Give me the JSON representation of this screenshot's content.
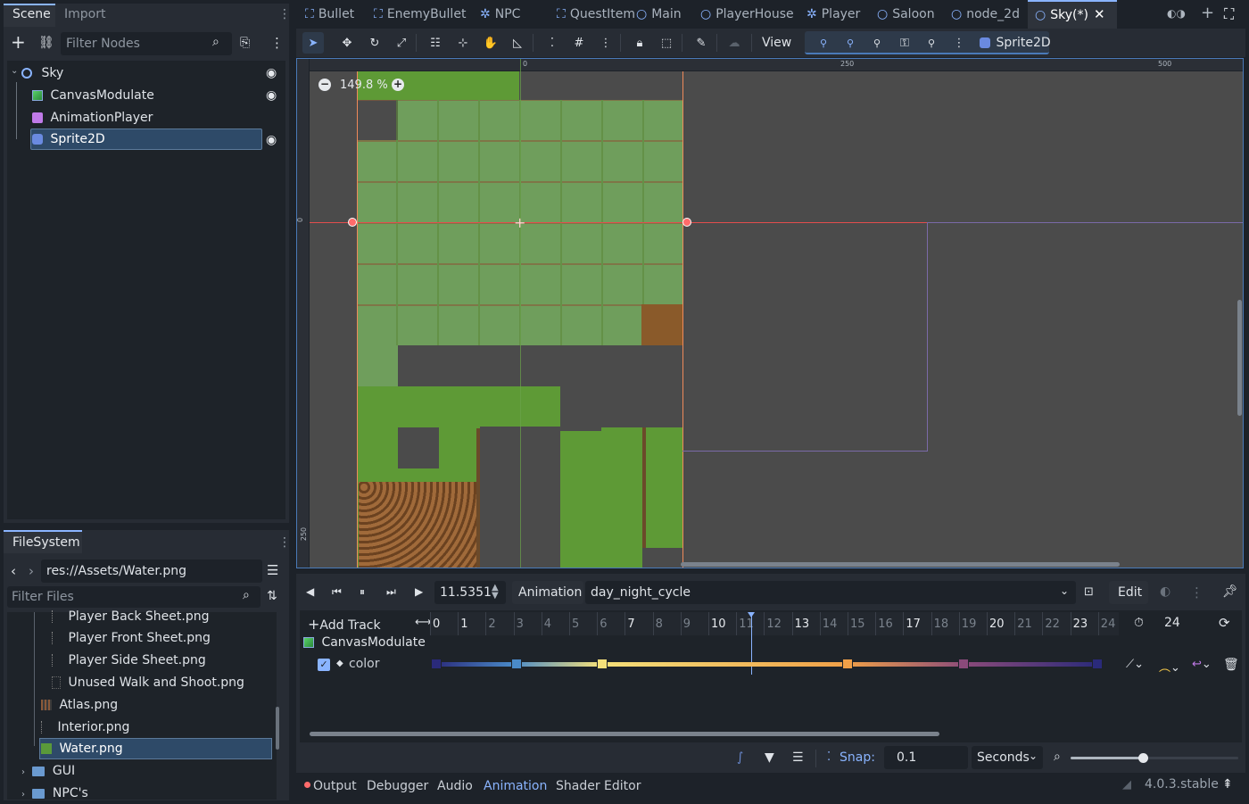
{
  "left_tabs": {
    "scene": "Scene",
    "import": "Import"
  },
  "scene_filter": {
    "placeholder": "Filter Nodes"
  },
  "scene_tree": [
    {
      "label": "Sky"
    },
    {
      "label": "CanvasModulate"
    },
    {
      "label": "AnimationPlayer"
    },
    {
      "label": "Sprite2D"
    }
  ],
  "filesystem": {
    "tab": "FileSystem",
    "path": "res://Assets/Water.png",
    "filter_placeholder": "Filter Files",
    "items": [
      {
        "label": "Player Back Sheet.png"
      },
      {
        "label": "Player Front Sheet.png"
      },
      {
        "label": "Player Side Sheet.png"
      },
      {
        "label": "Unused Walk and Shoot.png"
      },
      {
        "label": "Atlas.png"
      },
      {
        "label": "Interior.png"
      },
      {
        "label": "Water.png"
      },
      {
        "label": "GUI"
      },
      {
        "label": "NPC's"
      }
    ]
  },
  "scene_tabs": [
    "Bullet",
    "EnemyBullet",
    "NPC",
    "QuestItem",
    "Main",
    "PlayerHouse",
    "Player",
    "Saloon",
    "node_2d",
    "Sky(*)"
  ],
  "toolbar": {
    "view": "View",
    "sprite_node": "Sprite2D"
  },
  "viewport": {
    "zoom": "149.8 %",
    "ruler_top": [
      "0",
      "250",
      "500"
    ],
    "ruler_left": [
      "0",
      "250"
    ]
  },
  "animation": {
    "time": "11.5351",
    "label": "Animation",
    "current": "day_night_cycle",
    "edit": "Edit",
    "add_track": "Add Track",
    "timeline": [
      "0",
      "1",
      "2",
      "3",
      "4",
      "5",
      "6",
      "7",
      "8",
      "9",
      "10",
      "11",
      "12",
      "13",
      "14",
      "15",
      "16",
      "17",
      "18",
      "19",
      "20",
      "21",
      "22",
      "23",
      "24"
    ],
    "length": "24",
    "track_node": "CanvasModulate",
    "track_prop": "color",
    "snap_label": "Snap:",
    "snap_value": "0.1",
    "snap_unit": "Seconds",
    "keyframe_colors": [
      "#2a2a7a",
      "#4a8ac8",
      "#f4e07a",
      "#f0a048",
      "#8a4a7a",
      "#2a2a7a"
    ]
  },
  "bottom_tabs": [
    "Output",
    "Debugger",
    "Audio",
    "Animation",
    "Shader Editor"
  ],
  "version": "4.0.3.stable",
  "colors": {
    "accent": "#8ab4ff",
    "selection": "#2e4a68",
    "red_axis": "#e44d4d",
    "error_dot": "#ff6b6b"
  }
}
